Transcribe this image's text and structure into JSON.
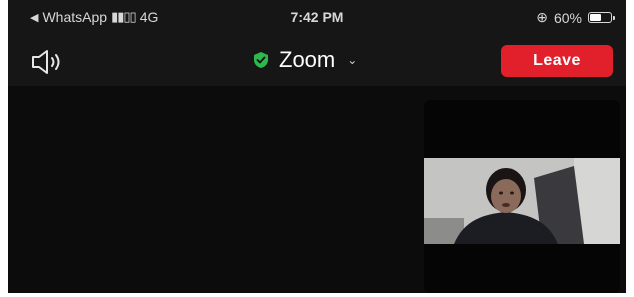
{
  "status_bar": {
    "back_app": "WhatsApp",
    "network": "4G",
    "time": "7:42 PM",
    "battery": "60%",
    "battery_level": 0.6
  },
  "header": {
    "title": "Zoom",
    "leave_label": "Leave",
    "icons": [
      "speaker-icon",
      "shield-check-icon",
      "chevron-down-icon"
    ]
  },
  "colors": {
    "background": "#0d0d0d",
    "leave_button": "#e2202c",
    "shield_green": "#2db84d"
  }
}
